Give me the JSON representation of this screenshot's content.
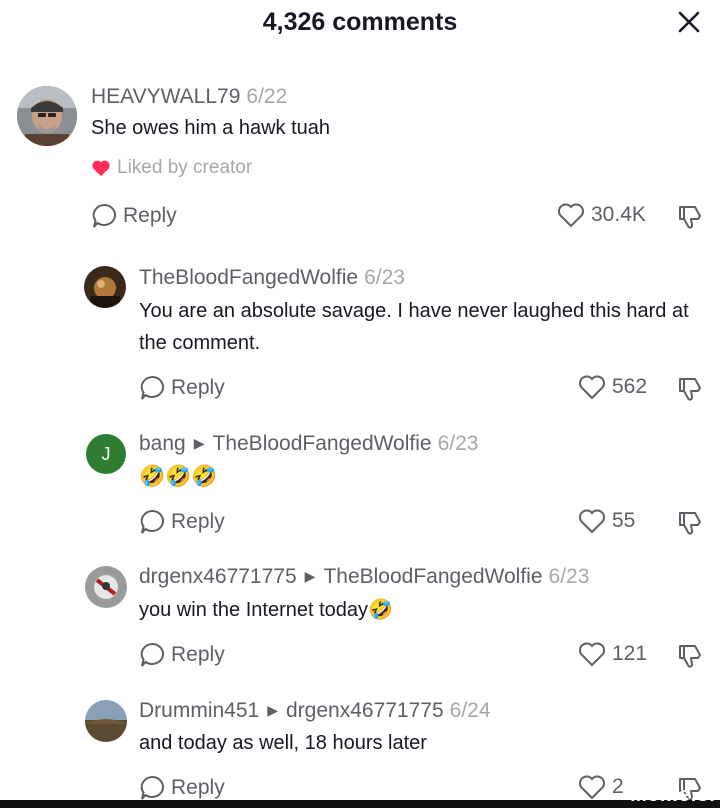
{
  "header": {
    "title": "4,326 comments"
  },
  "comments": [
    {
      "username": "HEAVYWALL79",
      "date": "6/22",
      "text": "She owes him a hawk tuah",
      "liked_by": "Liked by creator",
      "reply_label": "Reply",
      "likes": "30.4K"
    },
    {
      "username": "TheBloodFangedWolfie",
      "date": "6/23",
      "text": "You are an absolute savage. I have never laughed this hard at the comment.",
      "reply_label": "Reply",
      "likes": "562"
    },
    {
      "username": "bang",
      "reply_to": "TheBloodFangedWolfie",
      "date": "6/23",
      "avatar_initial": "J",
      "text": "🤣🤣🤣",
      "reply_label": "Reply",
      "likes": "55"
    },
    {
      "username": "drgenx46771775",
      "reply_to": "TheBloodFangedWolfie",
      "date": "6/23",
      "text": "you win the Internet today🤣",
      "reply_label": "Reply",
      "likes": "121"
    },
    {
      "username": "Drummin451",
      "reply_to": "drgenx46771775",
      "date": "6/24",
      "text": "and today as well, 18 hours later",
      "reply_label": "Reply",
      "likes": "2"
    }
  ],
  "colors": {
    "heart_red": "#fe2c55",
    "avatar_green": "#2e7d32",
    "muted": "#a6a7ab"
  },
  "icons": [
    "close-icon",
    "reply-bubble-icon",
    "heart-outline-icon",
    "dislike-icon",
    "heart-filled-icon"
  ],
  "watermark": "Meme.s."
}
